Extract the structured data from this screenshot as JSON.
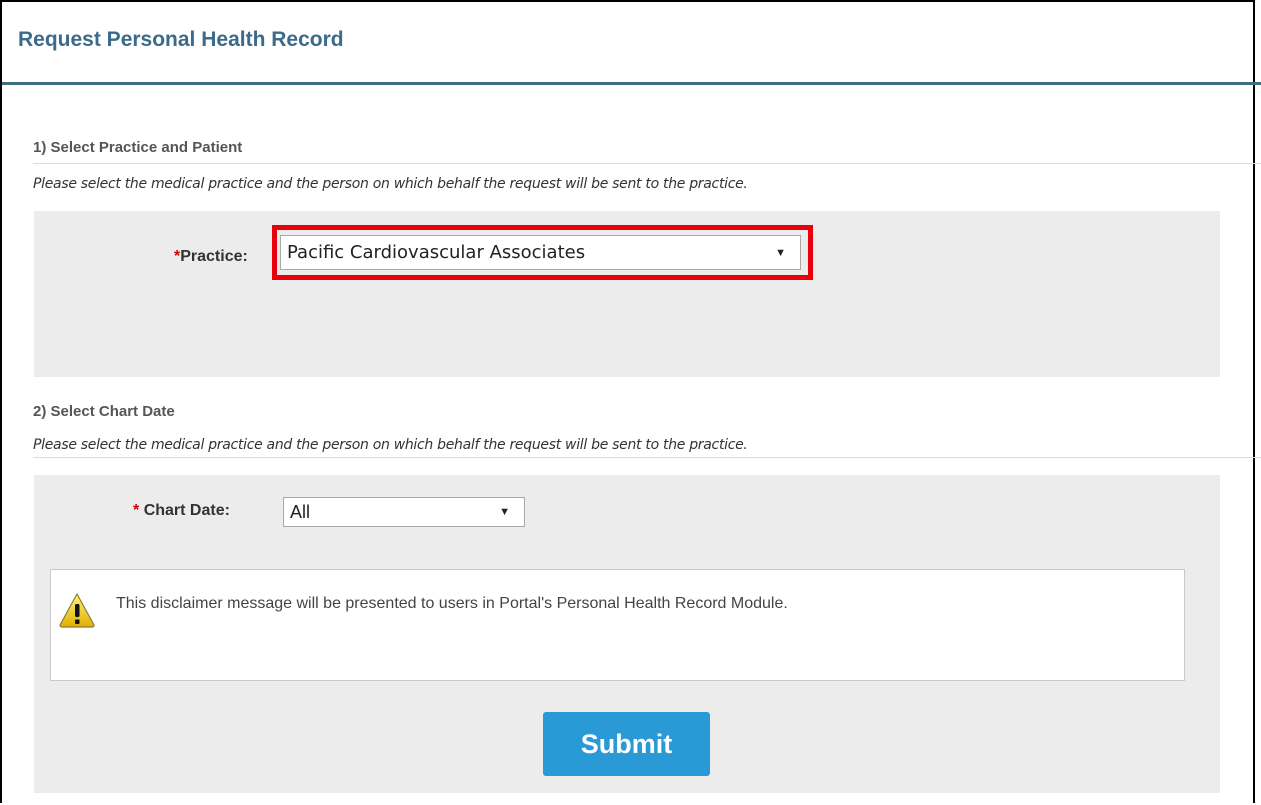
{
  "page": {
    "title": "Request Personal Health Record"
  },
  "section1": {
    "heading": "1) Select Practice and Patient",
    "description": "Please select the medical practice and the person on which behalf the request will be sent to the practice.",
    "practice_label_required": "*",
    "practice_label": "Practice:",
    "practice_selected": "Pacific Cardiovascular Associates"
  },
  "section2": {
    "heading": "2) Select Chart Date",
    "description": "Please select the medical practice and the person on which behalf the request will be sent to the practice.",
    "chart_date_label_required": "*",
    "chart_date_label": "Chart Date:",
    "chart_date_selected": "All"
  },
  "disclaimer": {
    "icon": "warning-icon",
    "text": "This disclaimer message will be presented to users in Portal's Personal Health Record Module."
  },
  "actions": {
    "submit_label": "Submit"
  },
  "colors": {
    "title": "#3b6a8a",
    "rule": "#416d84",
    "panel": "#ececec",
    "highlight": "#e8000a",
    "submit": "#2a9ad6",
    "required": "#d00000"
  },
  "icons": {
    "dropdown": "▼"
  }
}
